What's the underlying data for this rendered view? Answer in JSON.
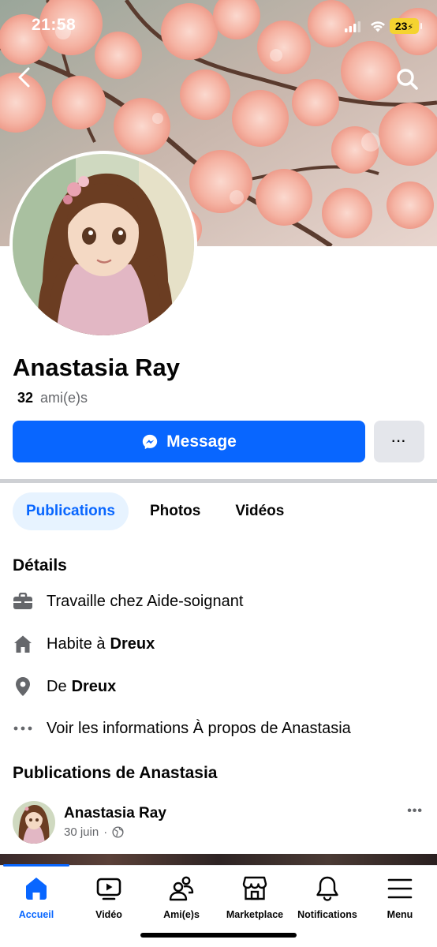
{
  "status_bar": {
    "time": "21:58",
    "battery": "23"
  },
  "profile": {
    "name": "Anastasia Ray",
    "friends_count": "32",
    "friends_label": "ami(e)s"
  },
  "actions": {
    "message_label": "Message",
    "more_label": "···"
  },
  "tabs": [
    {
      "label": "Publications",
      "active": true
    },
    {
      "label": "Photos"
    },
    {
      "label": "Vidéos"
    }
  ],
  "details": {
    "title": "Détails",
    "work": "Travaille chez Aide-soignant",
    "lives_prefix": "Habite à",
    "lives_city": "Dreux",
    "from_prefix": "De",
    "from_city": "Dreux",
    "about": "Voir les informations À propos de Anastasia"
  },
  "posts": {
    "title": "Publications de Anastasia",
    "first": {
      "author": "Anastasia Ray",
      "date": "30 juin",
      "separator": "·"
    }
  },
  "bottom_nav": [
    {
      "label": "Accueil",
      "icon": "home-icon",
      "active": true
    },
    {
      "label": "Vidéo",
      "icon": "video-icon"
    },
    {
      "label": "Ami(e)s",
      "icon": "friends-icon"
    },
    {
      "label": "Marketplace",
      "icon": "marketplace-icon"
    },
    {
      "label": "Notifications",
      "icon": "bell-icon"
    },
    {
      "label": "Menu",
      "icon": "menu-icon"
    }
  ],
  "colors": {
    "accent": "#0866ff",
    "tab_active_bg": "#e7f3ff",
    "secondary_text": "#65676b"
  }
}
